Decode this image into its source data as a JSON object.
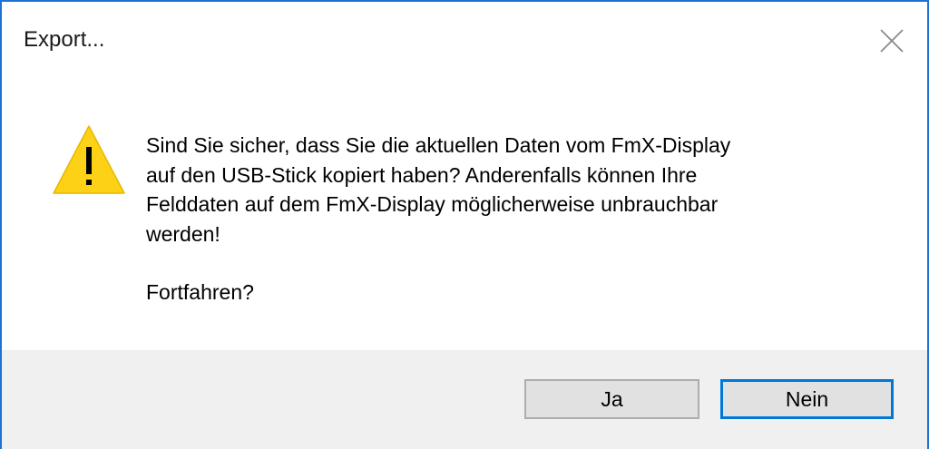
{
  "window": {
    "title": "Export..."
  },
  "message": {
    "line1": "Sind Sie sicher, dass Sie die aktuellen Daten vom FmX-Display",
    "line2": "auf den USB-Stick kopiert haben? Anderenfalls können Ihre",
    "line3": "Felddaten auf dem FmX-Display möglicherweise unbrauchbar",
    "line4": "werden!",
    "question": "Fortfahren?"
  },
  "buttons": {
    "yes_label": "Ja",
    "no_label": "Nein"
  },
  "colors": {
    "accent": "#0078d7",
    "window_border": "#1e72d4",
    "warning_yellow": "#fcd116",
    "footer_bg": "#f0f0f0"
  },
  "icons": {
    "warning": "warning-icon",
    "close": "close-icon"
  }
}
